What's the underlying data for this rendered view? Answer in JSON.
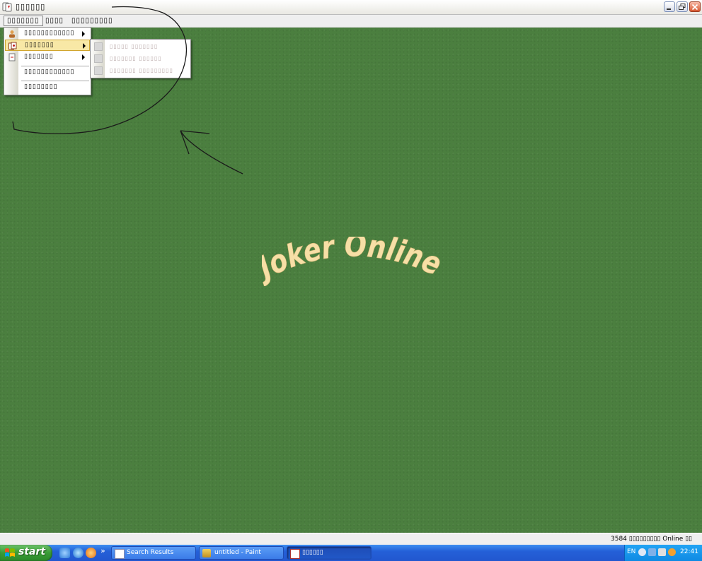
{
  "window": {
    "title": "▯▯▯▯▯▯"
  },
  "menubar": {
    "items": [
      "▯▯▯▯▯▯▯",
      "▯▯▯▯",
      "▯▯▯▯▯▯▯▯▯"
    ]
  },
  "dropdown": {
    "items": [
      {
        "label": "▯▯▯▯▯▯▯▯▯▯▯▯"
      },
      {
        "label": "▯▯▯▯▯▯▯"
      },
      {
        "label": "▯▯▯▯▯▯▯"
      },
      {
        "label": "▯▯▯▯▯▯▯▯▯▯▯▯"
      },
      {
        "label": "▯▯▯▯▯▯▯▯"
      }
    ]
  },
  "submenu": {
    "items": [
      {
        "label": "▯▯▯▯▯ ▯▯▯▯▯▯▯"
      },
      {
        "label": "▯▯▯▯▯▯▯ ▯▯▯▯▯▯"
      },
      {
        "label": "▯▯▯▯▯▯▯ ▯▯▯▯▯▯▯▯▯"
      }
    ]
  },
  "main": {
    "logo_text": "Joker Online"
  },
  "statusbar": {
    "text": "3584 ▯▯▯▯▯▯▯▯▯ Online ▯▯"
  },
  "taskbar": {
    "start_label": "start",
    "tasks": [
      {
        "label": "Search Results"
      },
      {
        "label": "untitled - Paint"
      },
      {
        "label": "▯▯▯▯▯▯"
      }
    ],
    "tray_lang": "EN",
    "clock": "22:41"
  },
  "colors": {
    "table_green": "#4b7f3f",
    "logo": "#f7dfa6",
    "menu_highlight": "#f8e8a6"
  }
}
